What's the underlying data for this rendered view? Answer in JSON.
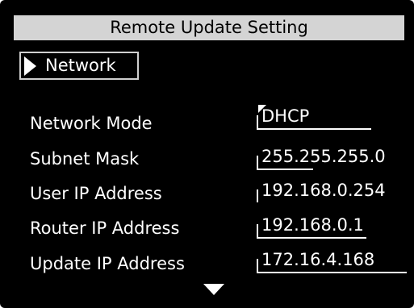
{
  "title": "Remote Update Setting",
  "tab": {
    "label": "Network",
    "icon": "triangle-right-icon"
  },
  "settings": [
    {
      "label": "Network Mode",
      "value": "DHCP"
    },
    {
      "label": "Subnet Mask",
      "value": "255.255.255.0"
    },
    {
      "label": "User IP Address",
      "value": "192.168.0.254"
    },
    {
      "label": "Router IP Address",
      "value": "192.168.0.1"
    },
    {
      "label": "Update IP Address",
      "value": "172.16.4.168"
    }
  ],
  "scroll_indicator": "triangle-down-icon",
  "colors": {
    "background": "#000000",
    "title_bar": "#d4d4d4",
    "text": "#ffffff"
  }
}
